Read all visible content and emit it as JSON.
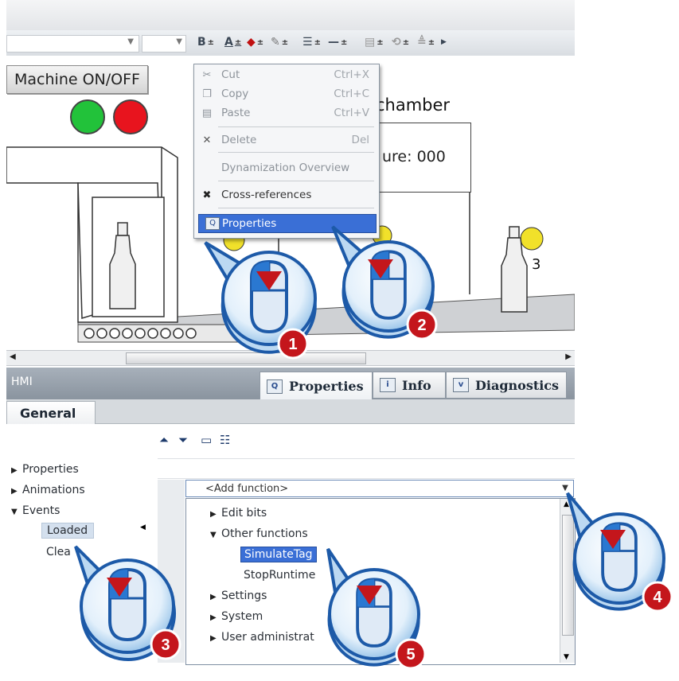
{
  "toolbar": {
    "bold_label": "B",
    "font_color_label": "A"
  },
  "canvas": {
    "machine_button_label": "Machine ON/OFF",
    "chamber_title": "chamber",
    "temperature_text": "ure: 000",
    "partial_label": "3",
    "lamp_colors": [
      "#22c23a",
      "#e8141e"
    ]
  },
  "context_menu": {
    "items": [
      {
        "label": "Cut",
        "shortcut": "Ctrl+X",
        "enabled": false,
        "icon": "scissors-icon"
      },
      {
        "label": "Copy",
        "shortcut": "Ctrl+C",
        "enabled": false,
        "icon": "copy-icon"
      },
      {
        "label": "Paste",
        "shortcut": "Ctrl+V",
        "enabled": false,
        "icon": "paste-icon"
      },
      {
        "label": "Delete",
        "shortcut": "Del",
        "enabled": false,
        "icon": "delete-icon"
      },
      {
        "label": "Dynamization Overview",
        "shortcut": "",
        "enabled": false,
        "icon": ""
      },
      {
        "label": "Cross-references",
        "shortcut": "",
        "enabled": true,
        "icon": "cross-references-icon"
      },
      {
        "label": "Properties",
        "shortcut": "",
        "enabled": true,
        "selected": true,
        "icon": "properties-icon"
      }
    ]
  },
  "inspector": {
    "title": "HMI",
    "tabs": [
      {
        "label": "Properties",
        "icon": "properties-icon",
        "active": true
      },
      {
        "label": "Info",
        "icon": "info-icon",
        "active": false
      },
      {
        "label": "Diagnostics",
        "icon": "diagnostics-icon",
        "active": false
      }
    ],
    "general_tab": "General",
    "nav": {
      "properties": "Properties",
      "animations": "Animations",
      "events": "Events",
      "loaded": "Loaded",
      "clea": "Clea"
    },
    "add_function": "<Add function>",
    "function_list": {
      "edit_bits": "Edit bits",
      "other_functions": "Other functions",
      "simulate_tag": "SimulateTag",
      "stop_runtime": "StopRuntime",
      "settings": "Settings",
      "system": "System",
      "user_admin": "User administrat"
    }
  },
  "callouts": [
    "1",
    "2",
    "3",
    "4",
    "5"
  ]
}
